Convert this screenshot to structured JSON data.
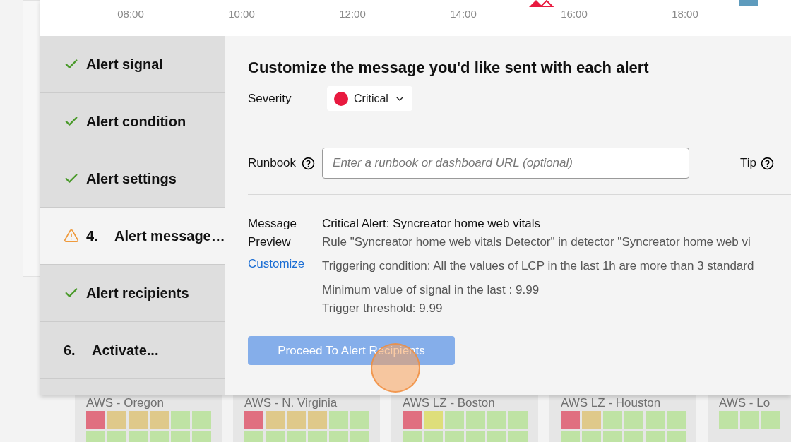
{
  "timeline": {
    "ticks": [
      "08:00",
      "10:00",
      "12:00",
      "14:00",
      "16:00",
      "18:00"
    ]
  },
  "steps": [
    {
      "kind": "done",
      "label": "Alert signal",
      "selected": false
    },
    {
      "kind": "done",
      "label": "Alert condition",
      "selected": false
    },
    {
      "kind": "done",
      "label": "Alert settings",
      "selected": false
    },
    {
      "kind": "warning",
      "number": "4.",
      "label": "Alert message…",
      "selected": true
    },
    {
      "kind": "done",
      "label": "Alert recipients",
      "selected": false
    },
    {
      "kind": "pending",
      "number": "6.",
      "label": "Activate...",
      "selected": false
    }
  ],
  "heading": "Customize the message you'd like sent with each alert",
  "severity": {
    "label": "Severity",
    "value": "Critical",
    "color": "#e8193f"
  },
  "runbook": {
    "label": "Runbook",
    "placeholder": "Enter a runbook or dashboard URL (optional)",
    "tip": "Tip"
  },
  "preview": {
    "label": "Message Preview",
    "customize": "Customize",
    "subject": "Critical Alert: Syncreator home web vitals",
    "lines": [
      "Rule \"Syncreator home web vitals Detector\" in detector \"Syncreator home web vi",
      "Triggering condition: All the values of LCP in the last 1h are more than 3 standard",
      "Minimum value of signal in the last : 9.99",
      "Trigger threshold: 9.99"
    ]
  },
  "proceed_button": "Proceed To Alert Recipients",
  "tiles": [
    {
      "name": "AWS - Oregon",
      "cells": [
        {
          "color": "#e06f80"
        },
        {
          "color": "#dfc98a"
        },
        {
          "color": "#dfc98a"
        },
        {
          "color": "#dfc98a"
        },
        {
          "color": "#bfe3a4"
        },
        {
          "color": "#bfe3a4"
        },
        {
          "color": "#bfe3a4"
        },
        {
          "color": "#bfe3a4"
        },
        {
          "color": "#bfe3a4"
        },
        {
          "color": "#bfe3a4"
        },
        {
          "color": "#bfe3a4"
        },
        {
          "color": "#bfe3a4"
        }
      ]
    },
    {
      "name": "AWS - N. Virginia",
      "cells": [
        {
          "color": "#e06f80"
        },
        {
          "color": "#dfc98a"
        },
        {
          "color": "#dfc98a"
        },
        {
          "color": "#dfc98a"
        },
        {
          "color": "#bfe3a4"
        },
        {
          "color": "#bfe3a4"
        },
        {
          "color": "#bfe3a4"
        },
        {
          "color": "#bfe3a4"
        },
        {
          "color": "#bfe3a4"
        },
        {
          "color": "#bfe3a4"
        },
        {
          "color": "#bfe3a4"
        },
        {
          "color": "#bfe3a4"
        }
      ]
    },
    {
      "name": "AWS LZ - Boston",
      "cells": [
        {
          "color": "#e06f80"
        },
        {
          "color": "#dede7a"
        },
        {
          "color": "#bfe3a4"
        },
        {
          "color": "#bfe3a4"
        },
        {
          "color": "#bfe3a4"
        },
        {
          "color": "#bfe3a4"
        },
        {
          "color": "#bfe3a4"
        },
        {
          "color": "#bfe3a4"
        },
        {
          "color": "#bfe3a4"
        },
        {
          "color": "#bfe3a4"
        },
        {
          "color": "#bfe3a4"
        },
        {
          "color": "#bfe3a4"
        }
      ]
    },
    {
      "name": "AWS LZ - Houston",
      "cells": [
        {
          "color": "#e06f80"
        },
        {
          "color": "#dfc98a"
        },
        {
          "color": "#bfe3a4"
        },
        {
          "color": "#bfe3a4"
        },
        {
          "color": "#bfe3a4"
        },
        {
          "color": "#bfe3a4"
        },
        {
          "color": "#bfe3a4"
        },
        {
          "color": "#bfe3a4"
        },
        {
          "color": "#bfe3a4"
        },
        {
          "color": "#bfe3a4"
        },
        {
          "color": "#bfe3a4"
        },
        {
          "color": "#bfe3a4"
        }
      ]
    },
    {
      "name": "AWS - Lo",
      "cells": [
        {
          "color": "#bfe3a4"
        },
        {
          "color": "#bfe3a4"
        },
        {
          "color": "#bfe3a4"
        }
      ]
    }
  ]
}
